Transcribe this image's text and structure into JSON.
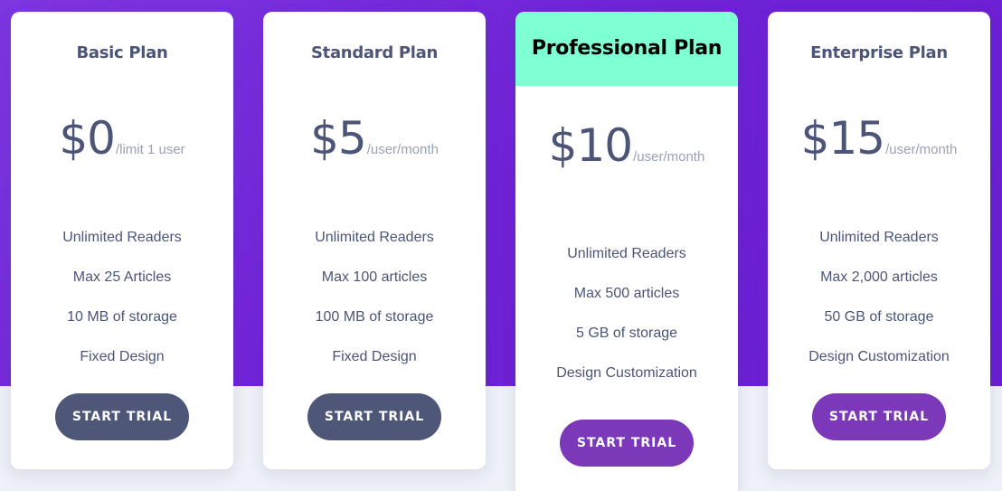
{
  "colors": {
    "hero_gradient_start": "#7d36e0",
    "hero_gradient_end": "#6a1ed2",
    "featured_header": "#7fffd4",
    "primary_text": "#4c5577",
    "muted_text": "#9aa0b8",
    "button_dark": "#4f5779",
    "button_purple": "#7b38b8"
  },
  "plans": [
    {
      "title": "Basic Plan",
      "price": "$0",
      "unit": "/limit 1 user",
      "features": [
        "Unlimited Readers",
        "Max 25 Articles",
        "10 MB of storage",
        "Fixed Design"
      ],
      "button": "START TRIAL",
      "featured": false
    },
    {
      "title": "Standard Plan",
      "price": "$5",
      "unit": "/user/month",
      "features": [
        "Unlimited Readers",
        "Max 100 articles",
        "100 MB of storage",
        "Fixed Design"
      ],
      "button": "START TRIAL",
      "featured": false
    },
    {
      "title": "Professional Plan",
      "price": "$10",
      "unit": "/user/month",
      "features": [
        "Unlimited Readers",
        "Max 500 articles",
        "5 GB of storage",
        "Design Customization"
      ],
      "button": "START TRIAL",
      "featured": true
    },
    {
      "title": "Enterprise Plan",
      "price": "$15",
      "unit": "/user/month",
      "features": [
        "Unlimited Readers",
        "Max 2,000 articles",
        "50 GB of storage",
        "Design Customization"
      ],
      "button": "START TRIAL",
      "featured": false
    }
  ]
}
